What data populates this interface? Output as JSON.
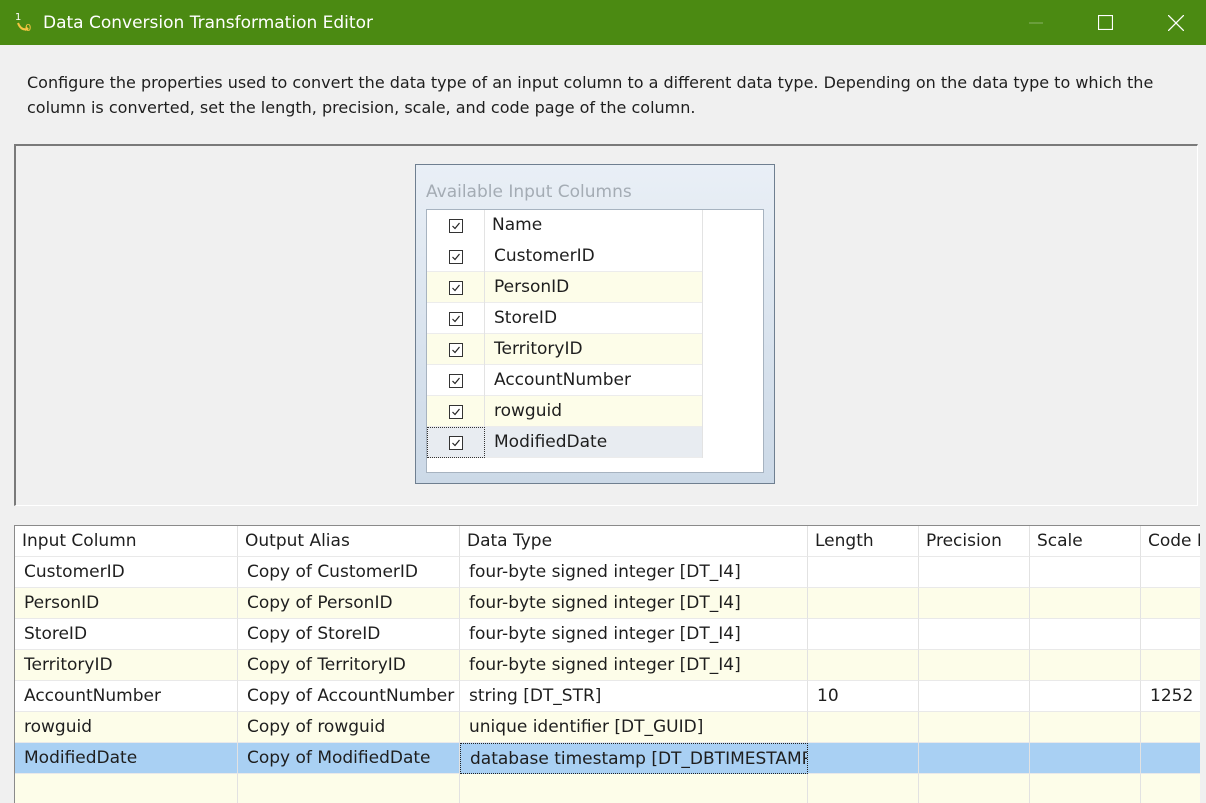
{
  "window": {
    "title": "Data Conversion Transformation Editor"
  },
  "description": "Configure the properties used to convert the data type of an input column to a different data type. Depending on the data type to which the column is converted, set the length, precision, scale, and code page of the column.",
  "available_columns": {
    "title": "Available Input Columns",
    "header": "Name",
    "items": [
      {
        "name": "CustomerID",
        "checked": true
      },
      {
        "name": "PersonID",
        "checked": true
      },
      {
        "name": "StoreID",
        "checked": true
      },
      {
        "name": "TerritoryID",
        "checked": true
      },
      {
        "name": "AccountNumber",
        "checked": true
      },
      {
        "name": "rowguid",
        "checked": true
      },
      {
        "name": "ModifiedDate",
        "checked": true
      }
    ]
  },
  "grid": {
    "headers": [
      "Input Column",
      "Output Alias",
      "Data Type",
      "Length",
      "Precision",
      "Scale",
      "Code P"
    ],
    "rows": [
      {
        "input": "CustomerID",
        "alias": "Copy of CustomerID",
        "type": "four-byte signed integer [DT_I4]",
        "length": "",
        "precision": "",
        "scale": "",
        "codepage": ""
      },
      {
        "input": "PersonID",
        "alias": "Copy of PersonID",
        "type": "four-byte signed integer [DT_I4]",
        "length": "",
        "precision": "",
        "scale": "",
        "codepage": ""
      },
      {
        "input": "StoreID",
        "alias": "Copy of StoreID",
        "type": "four-byte signed integer [DT_I4]",
        "length": "",
        "precision": "",
        "scale": "",
        "codepage": ""
      },
      {
        "input": "TerritoryID",
        "alias": "Copy of TerritoryID",
        "type": "four-byte signed integer [DT_I4]",
        "length": "",
        "precision": "",
        "scale": "",
        "codepage": ""
      },
      {
        "input": "AccountNumber",
        "alias": "Copy of AccountNumber",
        "type": "string [DT_STR]",
        "length": "10",
        "precision": "",
        "scale": "",
        "codepage": "1252"
      },
      {
        "input": "rowguid",
        "alias": "Copy of rowguid",
        "type": "unique identifier [DT_GUID]",
        "length": "",
        "precision": "",
        "scale": "",
        "codepage": ""
      },
      {
        "input": "ModifiedDate",
        "alias": "Copy of ModifiedDate",
        "type": "database timestamp [DT_DBTIMESTAMP]",
        "length": "",
        "precision": "",
        "scale": "",
        "codepage": ""
      }
    ],
    "selected_row": 6
  },
  "colors": {
    "titlebar": "#4b8a12",
    "selection": "#a9d0f3",
    "alt_row": "#fdfde9"
  },
  "icons": {
    "app": "data-conversion-icon",
    "minimize": "minimize-icon",
    "maximize": "maximize-icon",
    "close": "close-icon",
    "checkbox": "checkbox-checked-icon"
  }
}
